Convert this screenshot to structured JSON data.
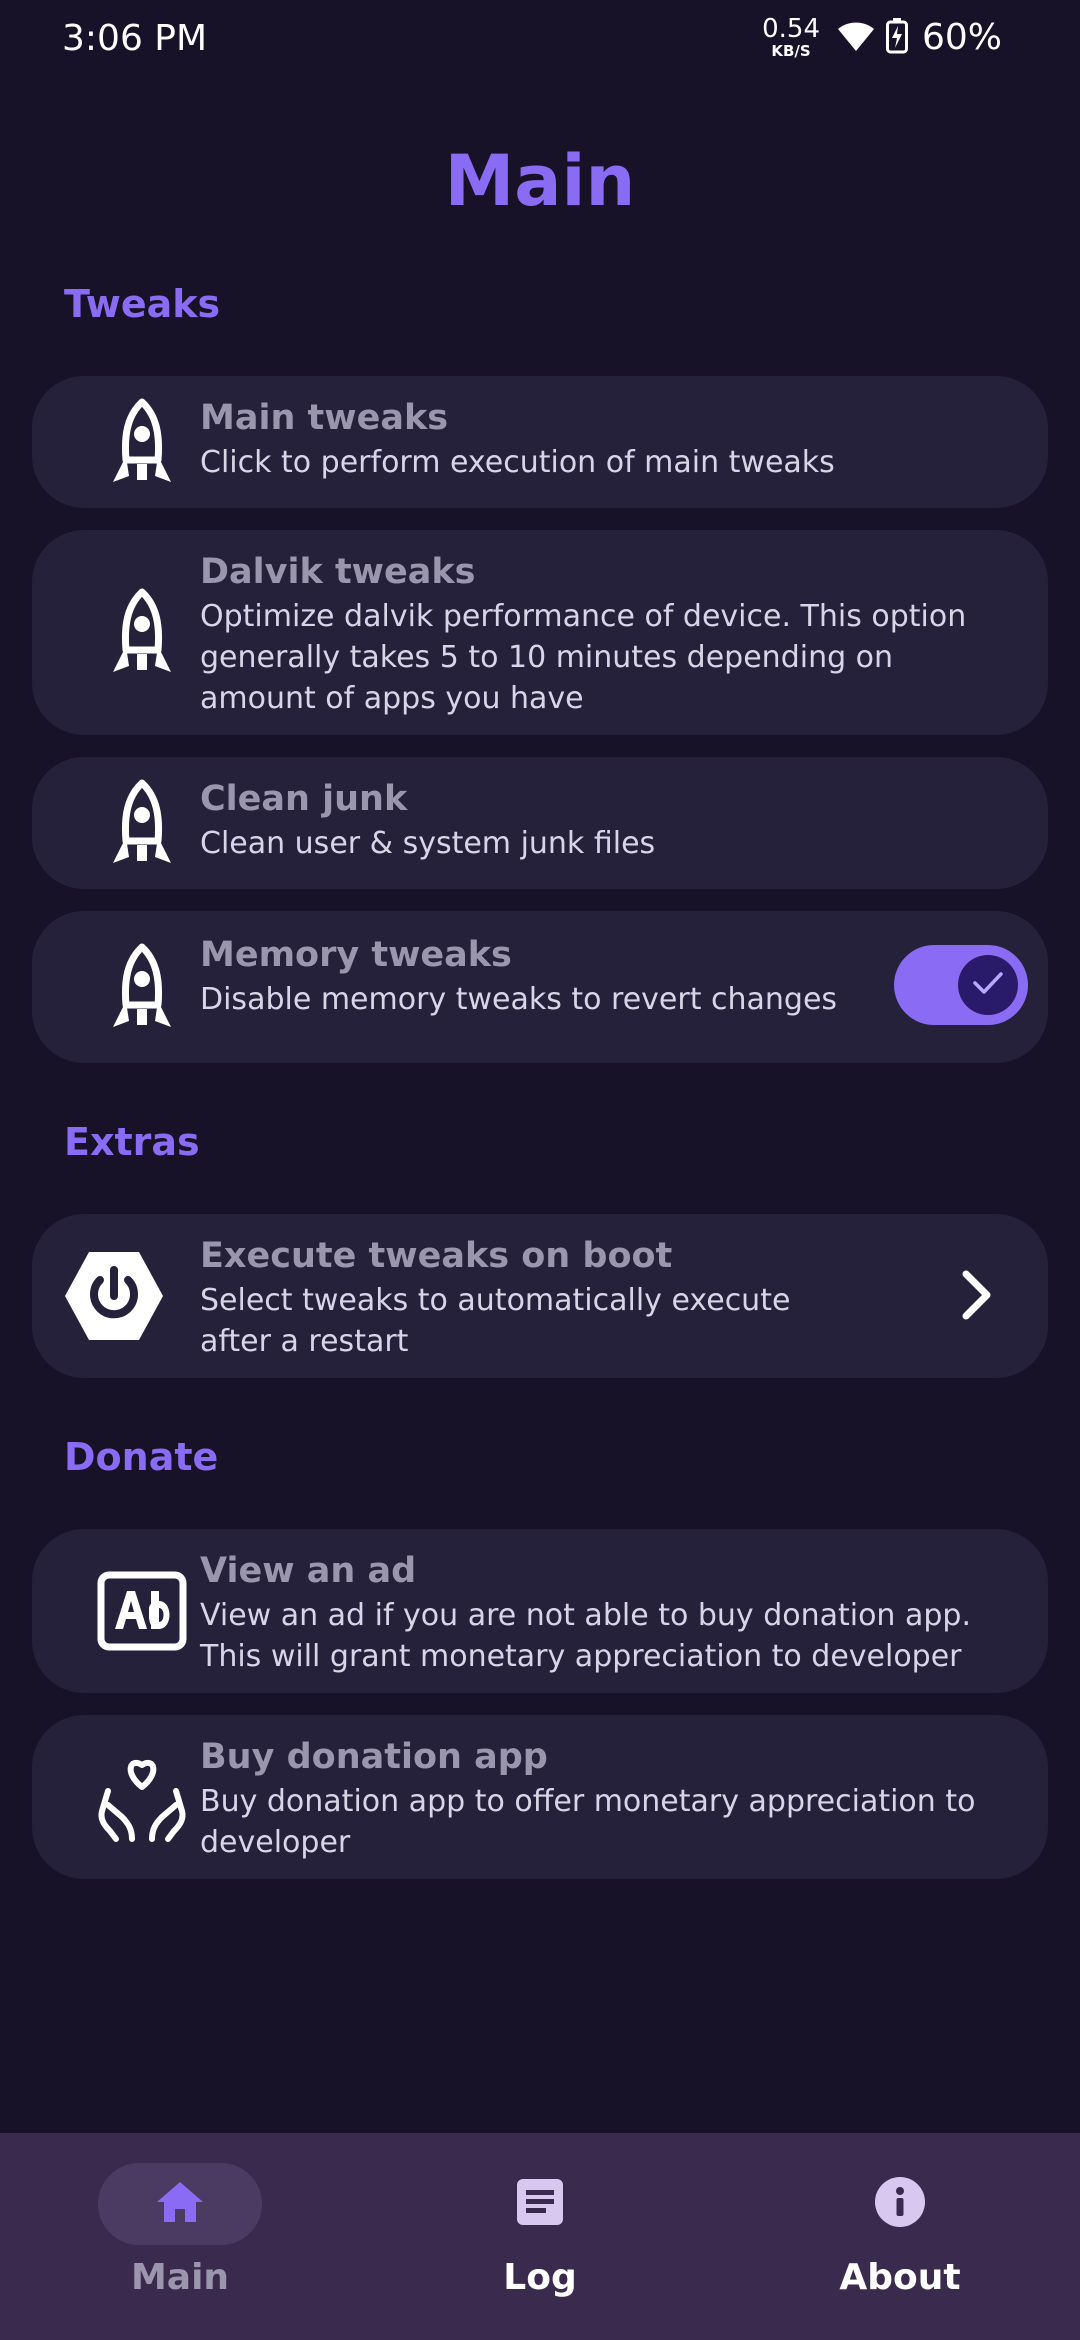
{
  "status_bar": {
    "time": "3:06 PM",
    "net_speed_value": "0.54",
    "net_speed_unit": "KB/S",
    "battery": "60%"
  },
  "page_title": "Main",
  "sections": {
    "tweaks": "Tweaks",
    "extras": "Extras",
    "donate": "Donate"
  },
  "items": {
    "main_tweaks": {
      "title": "Main tweaks",
      "desc": [
        "Click to perform execution of main tweaks"
      ]
    },
    "dalvik_tweaks": {
      "title": "Dalvik tweaks",
      "desc": [
        "Optimize dalvik performance of device. This option",
        "generally takes 5 to 10 minutes depending on",
        "amount of apps you have"
      ]
    },
    "clean_junk": {
      "title": "Clean junk",
      "desc": [
        "Clean user & system junk files"
      ]
    },
    "memory_tweaks": {
      "title": "Memory tweaks",
      "desc": [
        "Disable memory tweaks to revert changes"
      ],
      "toggle_on": true
    },
    "boot_tweaks": {
      "title": "Execute tweaks on boot",
      "desc": [
        "Select tweaks to automatically execute",
        "after a restart"
      ]
    },
    "view_ad": {
      "title": "View an ad",
      "desc": [
        "View an ad if you are not able to buy donation app.",
        "This will grant monetary appreciation to developer"
      ]
    },
    "buy_donation": {
      "title": "Buy donation app",
      "desc": [
        "Buy donation app to offer monetary appreciation to",
        "developer"
      ]
    }
  },
  "bottom_nav": {
    "main": "Main",
    "log": "Log",
    "about": "About"
  },
  "colors": {
    "background": "#171228",
    "accent": "#8a6cf4",
    "card": "#25213a",
    "bottom_nav": "#3a2a4d"
  }
}
